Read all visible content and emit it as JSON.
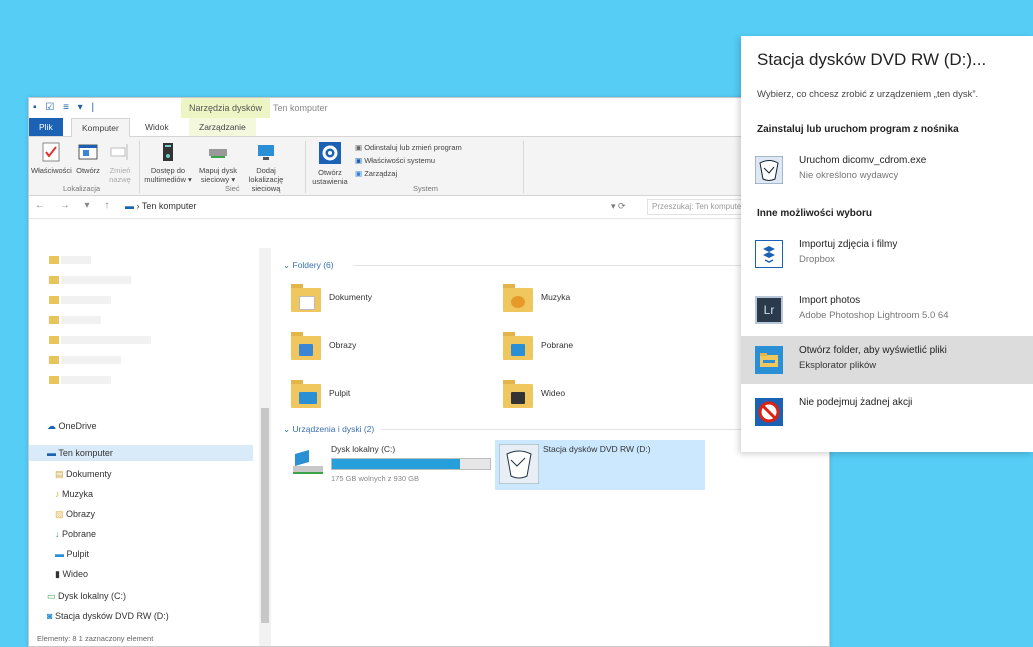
{
  "explorer": {
    "quick_access": "▪ ☑ ≡ ▾ |",
    "context_tab_title": "Narzędzia dysków",
    "window_title": "Ten komputer",
    "tabs": {
      "file": "Plik",
      "computer": "Komputer",
      "view": "Widok",
      "manage": "Zarządzanie"
    },
    "ribbon": {
      "properties": "Właściwości",
      "open": "Otwórz",
      "rename": "Zmień nazwę",
      "media_access": "Dostęp do multimediów ▾",
      "map_drive": "Mapuj dysk sieciowy ▾",
      "add_location": "Dodaj lokalizację sieciową",
      "open_settings": "Otwórz ustawienia",
      "uninstall": "Odinstaluj lub zmień program",
      "system_props": "Właściwości systemu",
      "manage_cmd": "Zarządzaj",
      "group_location": "Lokalizacja",
      "group_network": "Sieć",
      "group_system": "System"
    },
    "address": {
      "nav": "← → ▾ ↑",
      "breadcrumb": "› Ten komputer",
      "right_controls": "▾  ⟳",
      "search_placeholder": "Przeszukaj: Ten komputer"
    },
    "nav_pane": {
      "onedrive": "OneDrive",
      "this_pc": "Ten komputer",
      "items": [
        "Dokumenty",
        "Muzyka",
        "Obrazy",
        "Pobrane",
        "Pulpit",
        "Wideo"
      ],
      "local_disk": "Dysk lokalny (C:)",
      "dvd": "Stacja dysków DVD RW (D:)"
    },
    "content": {
      "folders_header": "Foldery (6)",
      "folders": [
        "Dokumenty",
        "Muzyka",
        "Obrazy",
        "Pobrane",
        "Pulpit",
        "Wideo"
      ],
      "devices_header": "Urządzenia i dyski (2)",
      "local_disk_name": "Dysk lokalny (C:)",
      "local_disk_free": "175 GB wolnych z 930 GB",
      "local_disk_used_fraction": 0.81,
      "dvd_name": "Stacja dysków DVD RW (D:)"
    },
    "status": "Elementy: 8     1 zaznaczony element"
  },
  "autoplay": {
    "title": "Stacja dysków DVD RW (D:)...",
    "description": "Wybierz, co chcesz zrobić z urządzeniem „ten dysk”.",
    "section_install": "Zainstaluj lub uruchom program z nośnika",
    "section_other": "Inne możliwości wyboru",
    "options": [
      {
        "line1": "Uruchom dicomv_cdrom.exe",
        "line2": "Nie określono wydawcy"
      },
      {
        "line1": "Importuj zdjęcia i filmy",
        "line2": "Dropbox"
      },
      {
        "line1": "Import photos",
        "line2": "Adobe Photoshop Lightroom 5.0 64"
      },
      {
        "line1": "Otwórz folder, aby wyświetlić pliki",
        "line2": "Eksplorator plików"
      },
      {
        "line1": "Nie podejmuj żadnej akcji",
        "line2": ""
      }
    ],
    "lr_badge": "Lr"
  },
  "colors": {
    "desktop": "#55cdf5",
    "accent": "#1b62b4",
    "selection": "#cce8ff"
  }
}
